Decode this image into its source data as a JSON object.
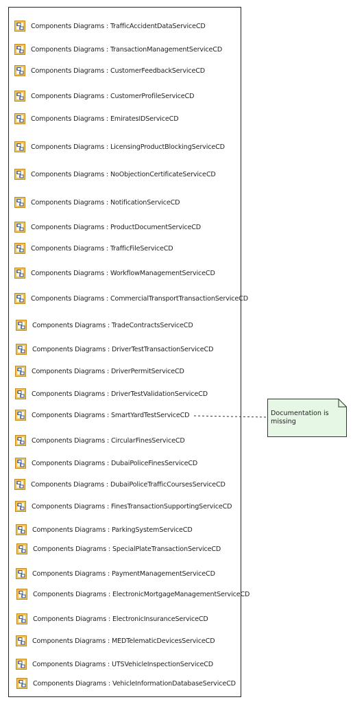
{
  "items": [
    {
      "label": "Components Diagrams : TrafficAccidentDataServiceCD"
    },
    {
      "label": "Components Diagrams : TransactionManagementServiceCD"
    },
    {
      "label": "Components Diagrams : CustomerFeedbackServiceCD"
    },
    {
      "label": "Components Diagrams : CustomerProfileServiceCD"
    },
    {
      "label": "Components Diagrams : EmiratesIDServiceCD"
    },
    {
      "label": "Components Diagrams : LicensingProductBlockingServiceCD"
    },
    {
      "label": "Components Diagrams : NoObjectionCertificateServiceCD"
    },
    {
      "label": "Components Diagrams : NotificationServiceCD"
    },
    {
      "label": "Components Diagrams : ProductDocumentServiceCD"
    },
    {
      "label": "Components Diagrams : TrafficFileServiceCD"
    },
    {
      "label": "Components Diagrams : WorkflowManagementServiceCD"
    },
    {
      "label": "Components Diagrams : CommercialTransportTransactionServiceCD"
    },
    {
      "label": "Components Diagrams : TradeContractsServiceCD"
    },
    {
      "label": "Components Diagrams : DriverTestTransactionServiceCD"
    },
    {
      "label": "Components Diagrams : DriverPermitServiceCD"
    },
    {
      "label": "Components Diagrams : DriverTestValidationServiceCD"
    },
    {
      "label": "Components Diagrams : SmartYardTestServiceCD"
    },
    {
      "label": "Components Diagrams : CircularFinesServiceCD"
    },
    {
      "label": "Components Diagrams : DubaiPoliceFinesServiceCD"
    },
    {
      "label": "Components Diagrams : DubaiPoliceTrafficCoursesServiceCD"
    },
    {
      "label": "Components Diagrams : FinesTransactionSupportingServiceCD"
    },
    {
      "label": "Components Diagrams : ParkingSystemServiceCD"
    },
    {
      "label": "Components Diagrams : SpecialPlateTransactionServiceCD"
    },
    {
      "label": "Components Diagrams : PaymentManagementServiceCD"
    },
    {
      "label": "Components Diagrams : ElectronicMortgageManagementServiceCD"
    },
    {
      "label": "Components Diagrams : ElectronicInsuranceServiceCD"
    },
    {
      "label": "Components Diagrams : MEDTelematicDevicesServiceCD"
    },
    {
      "label": "Components Diagrams : UTSVehicleInspectionServiceCD"
    },
    {
      "label": "Components Diagrams : VehicleInformationDatabaseServiceCD"
    }
  ],
  "note": {
    "text": "Documentation is missing"
  },
  "icon": "component-diagram-icon",
  "colors": {
    "note_fill": "#e6f7e6",
    "note_border": "#333333",
    "icon_fill": "#f2c75c",
    "icon_border": "#c0861a",
    "icon_glyph": "#3c5fa8"
  }
}
